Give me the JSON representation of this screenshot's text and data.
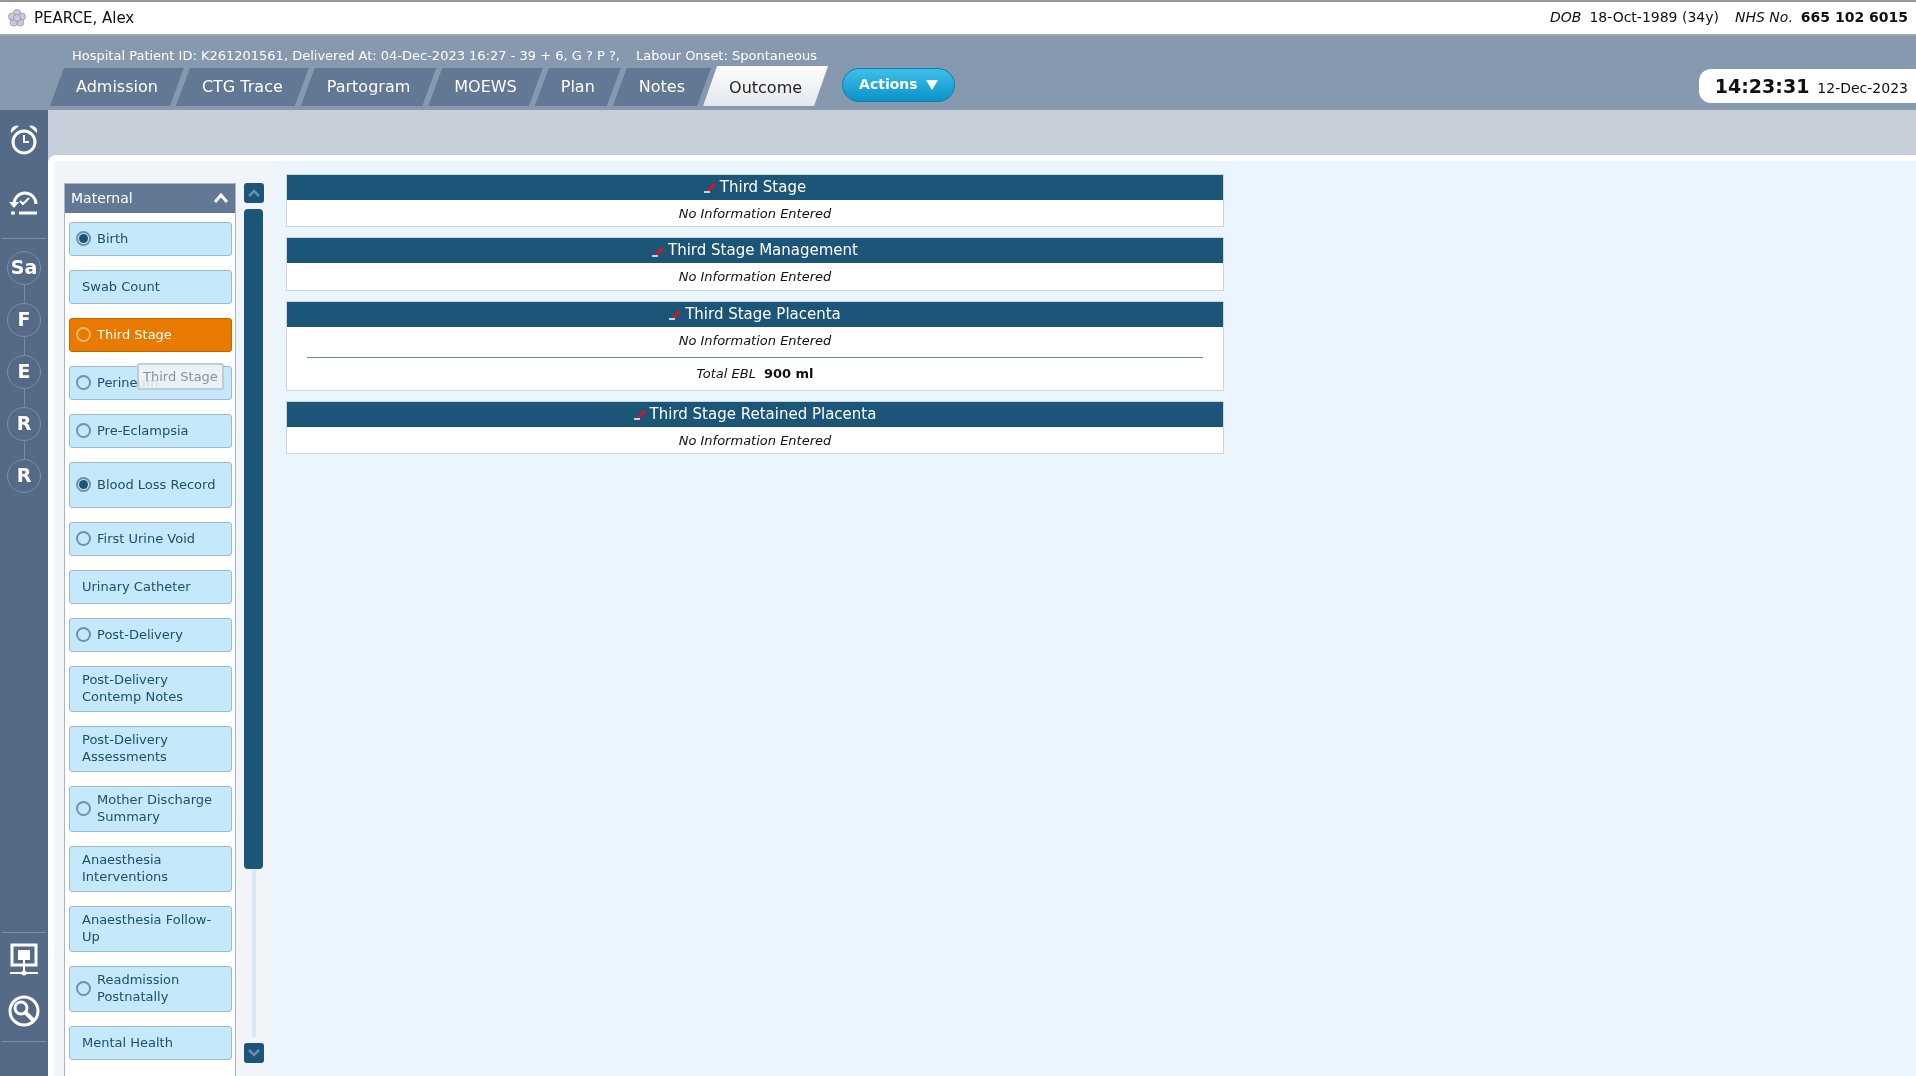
{
  "patient": {
    "name": "PEARCE, Alex",
    "dob_label": "DOB",
    "dob": "18-Oct-1989 (34y)",
    "nhs_label": "NHS No.",
    "nhs": "665 102 6015"
  },
  "banner": {
    "details": "Hospital Patient ID: K261201561, Delivered At: 04-Dec-2023 16:27 - 39 + 6, G ? P ?,",
    "labour_onset": "Labour Onset: Spontaneous"
  },
  "tabs": [
    {
      "label": "Admission",
      "selected": false
    },
    {
      "label": "CTG Trace",
      "selected": false
    },
    {
      "label": "Partogram",
      "selected": false
    },
    {
      "label": "MOEWS",
      "selected": false
    },
    {
      "label": "Plan",
      "selected": false
    },
    {
      "label": "Notes",
      "selected": false
    },
    {
      "label": "Outcome",
      "selected": true
    }
  ],
  "actions_button": {
    "label": "Actions"
  },
  "clock": {
    "time": "14:23:31",
    "date": "12-Dec-2023"
  },
  "rail": {
    "steps": [
      {
        "label": "Sa"
      },
      {
        "label": "F"
      },
      {
        "label": "E"
      },
      {
        "label": "R"
      },
      {
        "label": "R"
      }
    ]
  },
  "menu": {
    "title": "Maternal",
    "expanded": true,
    "items": [
      {
        "label": "Birth",
        "kind": "radio",
        "checked": true,
        "selected": false
      },
      {
        "label": "Swab Count",
        "kind": "plain",
        "selected": false
      },
      {
        "label": "Third Stage",
        "kind": "radio",
        "checked": false,
        "selected": true
      },
      {
        "label": "Perineum",
        "kind": "radio",
        "checked": false,
        "selected": false
      },
      {
        "label": "Pre-Eclampsia",
        "kind": "radio",
        "checked": false,
        "selected": false
      },
      {
        "label": "Blood Loss Record",
        "kind": "radio",
        "checked": true,
        "selected": false
      },
      {
        "label": "First Urine Void",
        "kind": "radio",
        "checked": false,
        "selected": false
      },
      {
        "label": "Urinary Catheter",
        "kind": "plain",
        "selected": false
      },
      {
        "label": "Post-Delivery",
        "kind": "radio",
        "checked": false,
        "selected": false
      },
      {
        "label": "Post-Delivery Contemp Notes",
        "kind": "plain",
        "selected": false
      },
      {
        "label": "Post-Delivery Assessments",
        "kind": "plain",
        "selected": false
      },
      {
        "label": "Mother Discharge Summary",
        "kind": "radio",
        "checked": false,
        "selected": false
      },
      {
        "label": "Anaesthesia Interventions",
        "kind": "plain",
        "selected": false
      },
      {
        "label": "Anaesthesia Follow-Up",
        "kind": "plain",
        "selected": false
      },
      {
        "label": "Readmission Postnatally",
        "kind": "radio",
        "checked": false,
        "selected": false
      },
      {
        "label": "Mental Health",
        "kind": "plain",
        "selected": false
      }
    ]
  },
  "tooltip": {
    "text": "Third Stage"
  },
  "sections": [
    {
      "title": "Third Stage",
      "empty_text": "No Information Entered"
    },
    {
      "title": "Third Stage Management",
      "empty_text": "No Information Entered"
    },
    {
      "title": "Third Stage Placenta",
      "empty_text": "No Information Entered",
      "fields": [
        {
          "label": "Total EBL",
          "value": "900 ml"
        }
      ]
    },
    {
      "title": "Third Stage Retained Placenta",
      "empty_text": "No Information Entered"
    }
  ]
}
